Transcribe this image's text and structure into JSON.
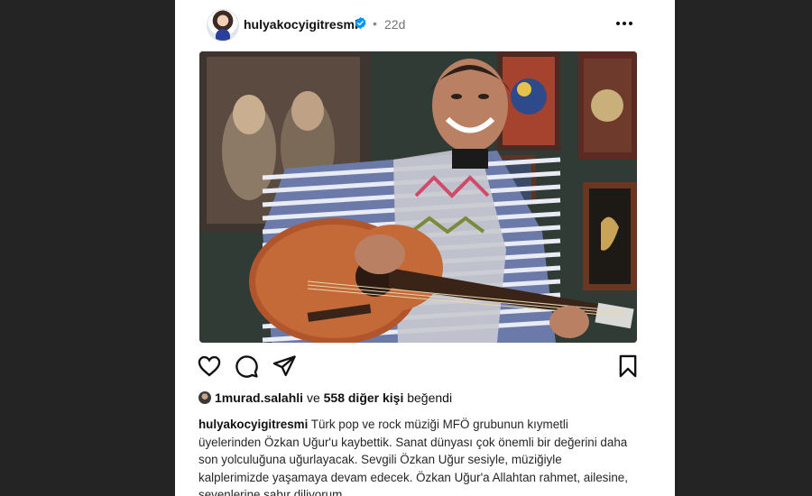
{
  "post": {
    "username": "hulyakocyigitresmi",
    "separator": "•",
    "time": "22d",
    "more_icon": "more-horizontal-icon",
    "verified_icon": "verified-badge-icon"
  },
  "actions": {
    "like_icon": "heart-icon",
    "comment_icon": "comment-icon",
    "share_icon": "send-icon",
    "save_icon": "bookmark-icon"
  },
  "likes": {
    "first_liker": "1murad.salahli",
    "and": "ve",
    "others": "558 diğer kişi",
    "liked": "beğendi"
  },
  "caption": {
    "username": "hulyakocyigitresmi",
    "text": "Türk pop ve rock müziği MFÖ grubunun kıymetli üyelerinden Özkan Uğur'u kaybettik. Sanat dünyası çok önemli bir değerini daha son yolculuğuna uğurlayacak. Sevgili Özkan Uğur sesiyle, müziğiyle kalplerimizde yaşamaya devam edecek. Özkan Uğur'a Allahtan rahmet, ailesine, sevenlerine sabır diliyorum."
  },
  "colors": {
    "background": "#242424",
    "card": "#ffffff",
    "verified": "#0095f6",
    "text": "#262626",
    "muted": "#737373"
  }
}
